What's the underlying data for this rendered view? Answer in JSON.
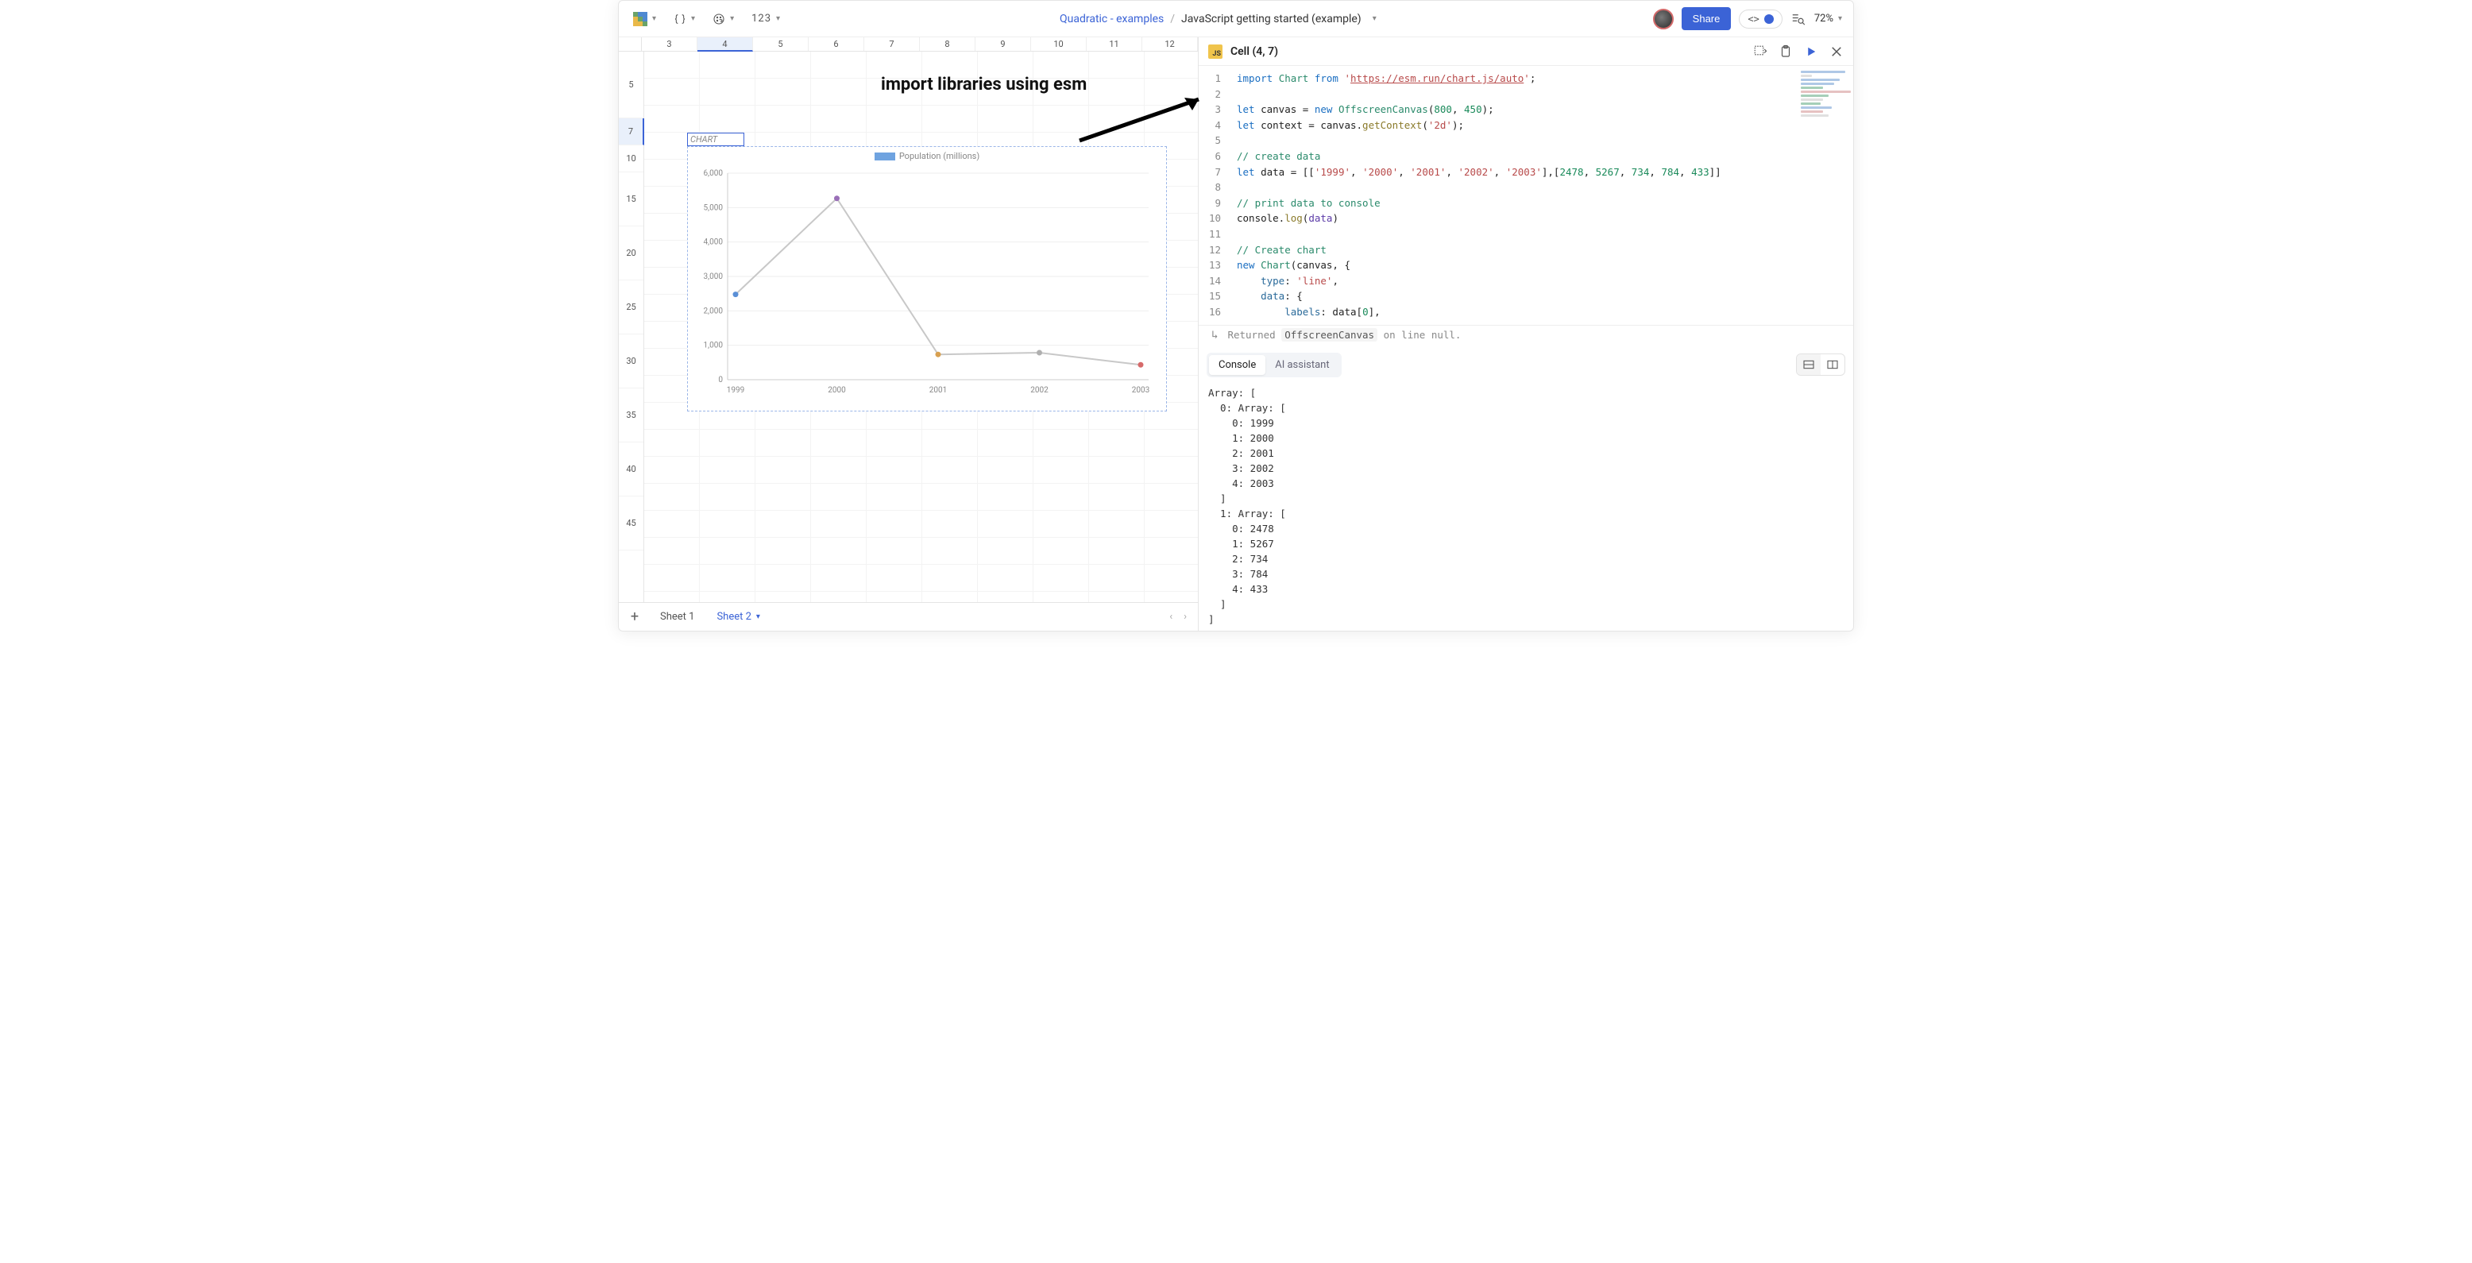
{
  "breadcrumb": {
    "root": "Quadratic - examples",
    "current": "JavaScript getting started (example)"
  },
  "toolbar": {
    "format_label": "123"
  },
  "share_label": "Share",
  "zoom_label": "72%",
  "annotation": "import libraries using esm",
  "columns": [
    "3",
    "4",
    "5",
    "6",
    "7",
    "8",
    "9",
    "10",
    "11",
    "12"
  ],
  "selected_col": "4",
  "rows": [
    "5",
    "7",
    "10",
    "15",
    "20",
    "25",
    "30",
    "35",
    "40",
    "45"
  ],
  "selected_row": "7",
  "active_cell_value": "CHART",
  "chart_data": {
    "type": "line",
    "title": "Population (millions)",
    "categories": [
      "1999",
      "2000",
      "2001",
      "2002",
      "2003"
    ],
    "values": [
      2478,
      5267,
      734,
      784,
      433
    ],
    "ylim": [
      0,
      6000
    ],
    "yticks": [
      0,
      1000,
      2000,
      3000,
      4000,
      5000,
      6000
    ],
    "series": [
      {
        "name": "Population (millions)",
        "values": [
          2478,
          5267,
          734,
          784,
          433
        ]
      }
    ]
  },
  "sheet_tabs": {
    "tab1": "Sheet 1",
    "tab2": "Sheet 2"
  },
  "cell_ref": "Cell (4, 7)",
  "code_lines": [
    {
      "n": "1",
      "tokens": [
        [
          "kw",
          "import"
        ],
        [
          "",
          " "
        ],
        [
          "cls",
          "Chart"
        ],
        [
          "",
          " "
        ],
        [
          "kw",
          "from"
        ],
        [
          "",
          " "
        ],
        [
          "str",
          "'"
        ],
        [
          "url",
          "https://esm.run/chart.js/auto"
        ],
        [
          "str",
          "'"
        ],
        [
          "",
          ";"
        ]
      ]
    },
    {
      "n": "2",
      "tokens": []
    },
    {
      "n": "3",
      "tokens": [
        [
          "kw",
          "let"
        ],
        [
          "",
          " canvas = "
        ],
        [
          "kw",
          "new"
        ],
        [
          "",
          " "
        ],
        [
          "cls",
          "OffscreenCanvas"
        ],
        [
          "",
          "("
        ],
        [
          "num",
          "800"
        ],
        [
          "",
          ", "
        ],
        [
          "num",
          "450"
        ],
        [
          "",
          ");"
        ]
      ]
    },
    {
      "n": "4",
      "tokens": [
        [
          "kw",
          "let"
        ],
        [
          "",
          " context = canvas."
        ],
        [
          "fn",
          "getContext"
        ],
        [
          "",
          "("
        ],
        [
          "str",
          "'2d'"
        ],
        [
          "",
          ");"
        ]
      ]
    },
    {
      "n": "5",
      "tokens": []
    },
    {
      "n": "6",
      "tokens": [
        [
          "cmt",
          "// create data"
        ]
      ]
    },
    {
      "n": "7",
      "tokens": [
        [
          "kw",
          "let"
        ],
        [
          "",
          " data = [["
        ],
        [
          "str",
          "'1999'"
        ],
        [
          "",
          ", "
        ],
        [
          "str",
          "'2000'"
        ],
        [
          "",
          ", "
        ],
        [
          "str",
          "'2001'"
        ],
        [
          "",
          ", "
        ],
        [
          "str",
          "'2002'"
        ],
        [
          "",
          ", "
        ],
        [
          "str",
          "'2003'"
        ],
        [
          "",
          "],["
        ],
        [
          "num",
          "2478"
        ],
        [
          "",
          ", "
        ],
        [
          "num",
          "5267"
        ],
        [
          "",
          ", "
        ],
        [
          "num",
          "734"
        ],
        [
          "",
          ", "
        ],
        [
          "num",
          "784"
        ],
        [
          "",
          ", "
        ],
        [
          "num",
          "433"
        ],
        [
          "",
          "]]"
        ]
      ]
    },
    {
      "n": "8",
      "tokens": []
    },
    {
      "n": "9",
      "tokens": [
        [
          "cmt",
          "// print data to console"
        ]
      ]
    },
    {
      "n": "10",
      "tokens": [
        [
          "",
          "console."
        ],
        [
          "fn",
          "log"
        ],
        [
          "",
          "("
        ],
        [
          "id",
          "data"
        ],
        [
          "",
          ")"
        ]
      ]
    },
    {
      "n": "11",
      "tokens": []
    },
    {
      "n": "12",
      "tokens": [
        [
          "cmt",
          "// Create chart"
        ]
      ]
    },
    {
      "n": "13",
      "tokens": [
        [
          "kw",
          "new"
        ],
        [
          "",
          " "
        ],
        [
          "cls",
          "Chart"
        ],
        [
          "",
          "(canvas, {"
        ]
      ]
    },
    {
      "n": "14",
      "tokens": [
        [
          "",
          "    "
        ],
        [
          "prop",
          "type"
        ],
        [
          "",
          ": "
        ],
        [
          "str",
          "'line'"
        ],
        [
          "",
          ","
        ]
      ]
    },
    {
      "n": "15",
      "tokens": [
        [
          "",
          "    "
        ],
        [
          "prop",
          "data"
        ],
        [
          "",
          ": {"
        ]
      ]
    },
    {
      "n": "16",
      "tokens": [
        [
          "",
          "        "
        ],
        [
          "prop",
          "labels"
        ],
        [
          "",
          ": data["
        ],
        [
          "num",
          "0"
        ],
        [
          "",
          "],"
        ]
      ]
    }
  ],
  "return_line": {
    "prefix": "Returned",
    "value": "OffscreenCanvas",
    "suffix": "on line null."
  },
  "panel_tabs": {
    "console": "Console",
    "ai": "AI assistant"
  },
  "console_output": "Array: [\n  0: Array: [\n    0: 1999\n    1: 2000\n    2: 2001\n    3: 2002\n    4: 2003\n  ]\n  1: Array: [\n    0: 2478\n    1: 5267\n    2: 734\n    3: 784\n    4: 433\n  ]\n]"
}
